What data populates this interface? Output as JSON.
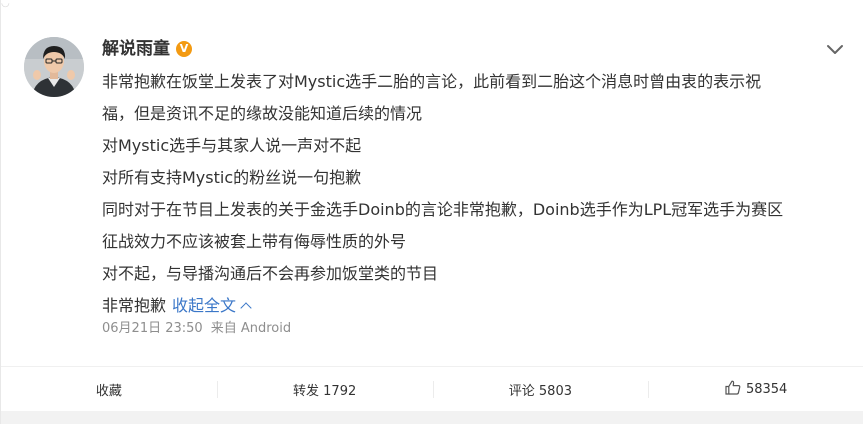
{
  "post": {
    "author": "解说雨童",
    "content_lines": [
      "非常抱歉在饭堂上发表了对Mystic选手二胎的言论，此前看到二胎这个消息时曾由衷的表示祝",
      "福，但是资讯不足的缘故没能知道后续的情况",
      "对Mystic选手与其家人说一声对不起",
      "对所有支持Mystic的粉丝说一句抱歉",
      "同时对于在节目上发表的关于金选手Doinb的言论非常抱歉，Doinb选手作为LPL冠军选手为赛区",
      "征战效力不应该被套上带有侮辱性质的外号",
      "对不起，与导播沟通后不会再参加饭堂类的节目",
      "非常抱歉"
    ],
    "collapse_label": "收起全文",
    "timestamp": "06月21日 23:50",
    "source": "来自 Android"
  },
  "actions": {
    "favorite": "收藏",
    "repost": "转发 1792",
    "comment": "评论 5803",
    "like_count": "58354"
  },
  "icons": {
    "verified_badge": "V",
    "more": "chevron-down-icon",
    "like": "thumbs-up-icon"
  },
  "colors": {
    "link": "#3b77c8",
    "badge": "#f39a12",
    "text": "#333333",
    "muted": "#8e8e8e"
  }
}
